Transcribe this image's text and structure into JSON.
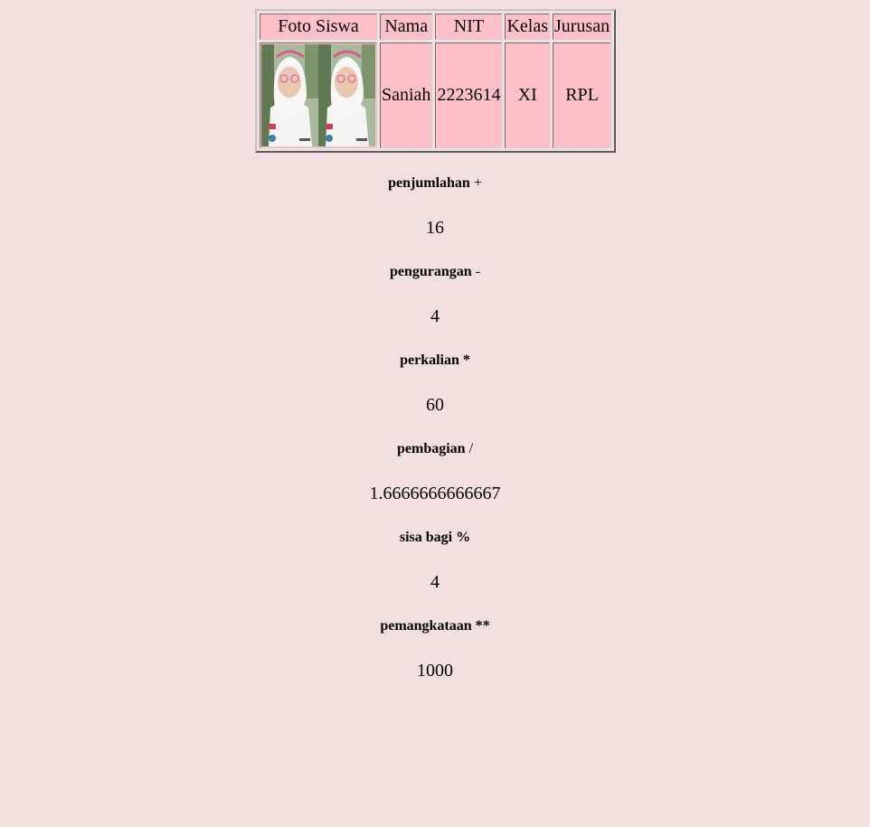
{
  "table": {
    "headers": [
      "Foto Siswa",
      "Nama",
      "NIT",
      "Kelas",
      "Jurusan"
    ],
    "row": {
      "photo": "student-photo",
      "nama": "Saniah",
      "nit": "2223614",
      "kelas": "XI",
      "jurusan": "RPL"
    }
  },
  "operations": [
    {
      "label": "penjumlahan",
      "symbol": "+",
      "symbol_bold": false,
      "result": "16"
    },
    {
      "label": "pengurangan",
      "symbol": "-",
      "symbol_bold": false,
      "result": "4"
    },
    {
      "label": "perkalian",
      "symbol": "*",
      "symbol_bold": true,
      "result": "60"
    },
    {
      "label": "pembagian",
      "symbol": "/",
      "symbol_bold": false,
      "result": "1.6666666666667"
    },
    {
      "label": "sisa bagi",
      "symbol": "%",
      "symbol_bold": true,
      "result": "4"
    },
    {
      "label": "pemangkataan",
      "symbol": "**",
      "symbol_bold": true,
      "result": "1000"
    }
  ],
  "colors": {
    "background": "#f2dfdf",
    "cell": "#ffc0cb"
  }
}
